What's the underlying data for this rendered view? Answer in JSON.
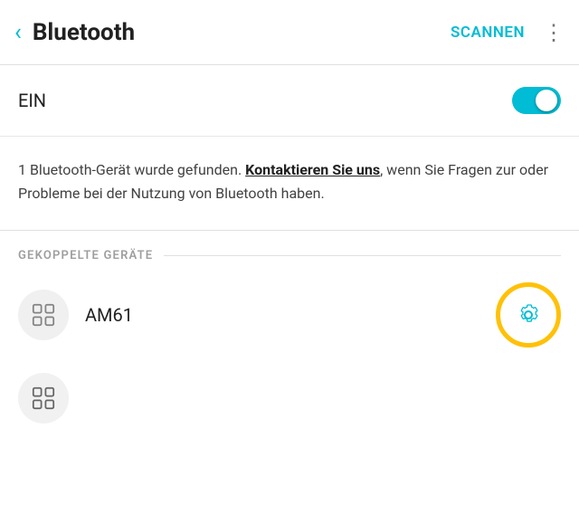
{
  "header": {
    "back_label": "‹",
    "title": "Bluetooth",
    "scan_label": "SCANNEN",
    "more_label": "⋮"
  },
  "ein_section": {
    "label": "EIN"
  },
  "info_section": {
    "text_before_link": "1 Bluetooth-Gerät wurde gefunden. ",
    "link_text": "Kontaktieren Sie uns",
    "text_after_link": ", wenn Sie Fragen zur oder Probleme bei der Nutzung von Bluetooth haben."
  },
  "paired_section": {
    "header": "GEKOPPELTE GERÄTE"
  },
  "device": {
    "name": "AM61"
  },
  "colors": {
    "accent": "#00BCD4",
    "highlight": "#FFC107",
    "text_primary": "#212121",
    "text_secondary": "#9e9e9e"
  }
}
